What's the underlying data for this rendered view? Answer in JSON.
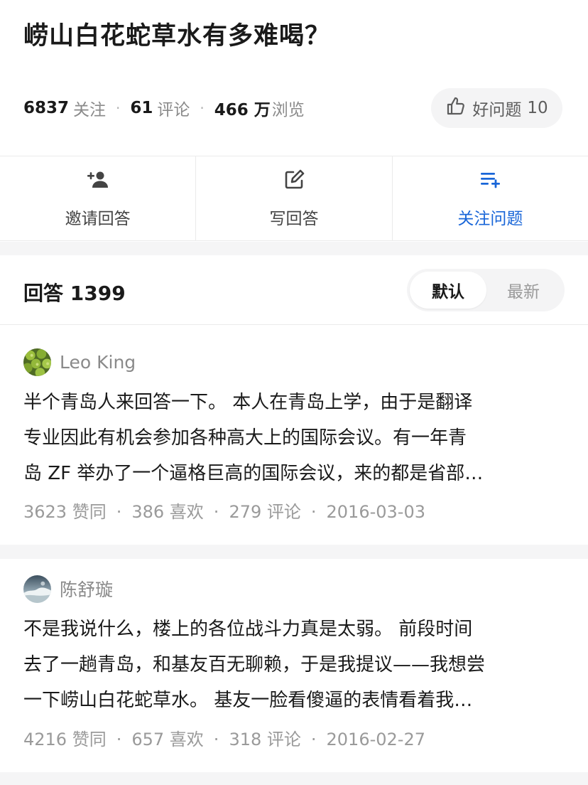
{
  "question": {
    "title": "崂山白花蛇草水有多难喝？",
    "followers": "6837",
    "followers_label": "关注",
    "comments": "61",
    "comments_label": "评论",
    "views": "466 万",
    "views_label": "浏览",
    "good_question_label": "好问题",
    "good_question_count": "10"
  },
  "actions": {
    "invite": "邀请回答",
    "write": "写回答",
    "follow": "关注问题"
  },
  "answers_header": {
    "label": "回答",
    "count": "1399",
    "sort_default": "默认",
    "sort_latest": "最新"
  },
  "answers": [
    {
      "author": "Leo King",
      "lines": [
        "半个青岛人来回答一下。 本人在青岛上学，由于是翻译",
        "专业因此有机会参加各种高大上的国际会议。有一年青",
        "岛 ZF 举办了一个逼格巨高的国际会议，来的都是省部…"
      ],
      "likes": "3623 赞同",
      "favs": "386 喜欢",
      "comments": "279 评论",
      "date": "2016-03-03"
    },
    {
      "author": "陈舒璇",
      "lines": [
        "不是我说什么，楼上的各位战斗力真是太弱。 前段时间",
        "去了一趟青岛，和基友百无聊赖，于是我提议——我想尝",
        "一下崂山白花蛇草水。 基友一脸看傻逼的表情看着我…"
      ],
      "likes": "4216 赞同",
      "favs": "657 喜欢",
      "comments": "318 评论",
      "date": "2016-02-27"
    }
  ],
  "colors": {
    "accent": "#1966d8",
    "muted": "#8a8a8a",
    "separator": "#f5f5f6"
  }
}
